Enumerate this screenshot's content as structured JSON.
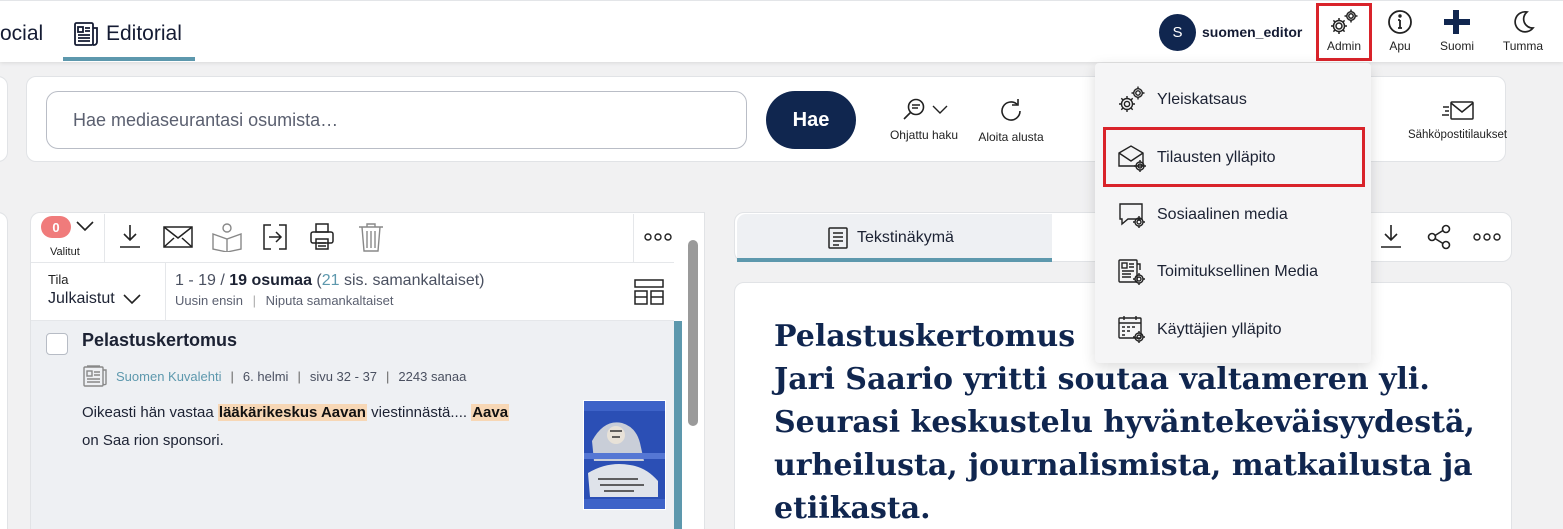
{
  "header": {
    "tabs": [
      {
        "label": "ocial"
      },
      {
        "label": "Editorial"
      }
    ],
    "user": {
      "initial": "S",
      "name": "suomen_editor"
    },
    "actions": [
      {
        "label": "Admin",
        "icon": "gears-icon"
      },
      {
        "label": "Apu",
        "icon": "info-icon"
      },
      {
        "label": "Suomi",
        "icon": "finnish-flag-icon"
      },
      {
        "label": "Tumma",
        "icon": "moon-icon"
      }
    ]
  },
  "search": {
    "placeholder": "Hae mediaseurantasi osumista…",
    "button": "Hae",
    "guided_label": "Ohjattu haku",
    "restart_label": "Aloita alusta",
    "email_orders_label": "Sähköpostitilaukset"
  },
  "results": {
    "selected_count": "0",
    "selected_label": "Valitut",
    "state_label": "Tila",
    "state_value": "Julkaistut",
    "range": "1 - 19 / ",
    "hits": "19 osumaa",
    "similar_open": " (",
    "similar_count": "21",
    "similar_close": " sis. samankaltaiset)",
    "sort_newest": "Uusin ensin",
    "sort_sep": "|",
    "bundle_similar": "Niputa samankaltaiset",
    "items": [
      {
        "title": "Pelastuskertomus",
        "source": "Suomen Kuvalehti",
        "date": "6. helmi",
        "page": "sivu 32 - 37",
        "words": "2243 sanaa",
        "sep": "|",
        "snippet_pre": "Oikeasti hän vastaa ",
        "hl1": "lääkärikeskus Aavan",
        "snippet_mid": " viestinnästä.... ",
        "hl2": "Aava",
        "snippet_post": "on Saa rion sponsori."
      }
    ]
  },
  "article": {
    "tab_text_view": "Tekstinäkymä",
    "headline_1": "Pelastuskertomus",
    "headline_2": "Jari Saario yritti soutaa valtameren yli. Seurasi keskustelu hyväntekeväisyydestä, urheilusta, journalismista, matkailusta ja etiikasta."
  },
  "admin_menu": {
    "items": [
      {
        "label": "Yleiskatsaus",
        "icon": "gears-icon"
      },
      {
        "label": "Tilausten ylläpito",
        "icon": "envelope-gear-icon"
      },
      {
        "label": "Sosiaalinen media",
        "icon": "chat-gear-icon"
      },
      {
        "label": "Toimituksellinen Media",
        "icon": "newspaper-gear-icon"
      },
      {
        "label": "Käyttäjien ylläpito",
        "icon": "calendar-gear-icon"
      }
    ]
  },
  "colors": {
    "navy": "#10264f",
    "accent": "#5d98ad",
    "highlight_box": "#d9232a",
    "badge": "#f07b7b",
    "keyword_highlight": "#f7d7b5"
  }
}
